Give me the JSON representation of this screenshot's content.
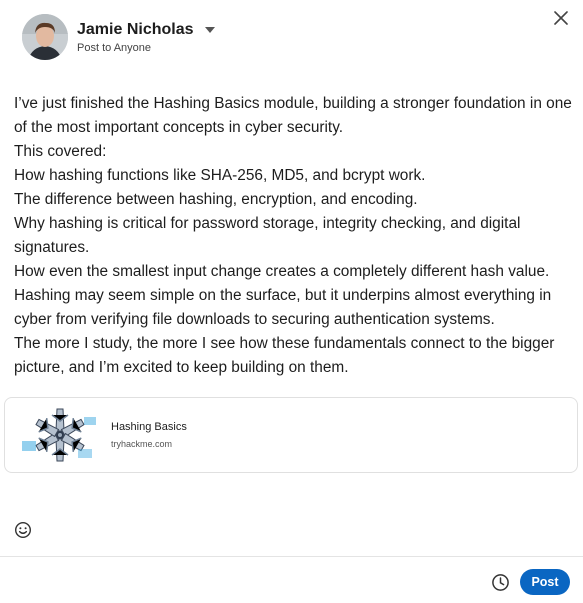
{
  "header": {
    "author_name": "Jamie Nicholas",
    "audience": "Post to Anyone",
    "avatar_icon": "profile-photo"
  },
  "icons": {
    "close": "close-icon",
    "caret": "chevron-down-icon",
    "emoji": "emoji-icon",
    "schedule": "clock-icon"
  },
  "post": {
    "lines": [
      "I’ve just finished the Hashing Basics module, building a stronger foundation in one of the most important concepts in cyber security.",
      "This covered:",
      "How hashing functions like SHA-256, MD5, and bcrypt work.",
      "The difference between hashing, encryption, and encoding.",
      "Why hashing is critical for password storage, integrity checking, and digital signatures.",
      "How even the smallest input change creates a completely different hash value.",
      "Hashing may seem simple on the surface, but it underpins almost everything in cyber from verifying file downloads to securing authentication systems.",
      "The more I study, the more I see how these fundamentals connect to the bigger picture, and I’m excited to keep building on them."
    ]
  },
  "link_card": {
    "title": "Hashing Basics",
    "domain": "tryhackme.com"
  },
  "footer": {
    "post_label": "Post"
  },
  "colors": {
    "accent": "#0a66c2",
    "text": "#1d1d1d",
    "card_border": "#e0e0e0"
  }
}
